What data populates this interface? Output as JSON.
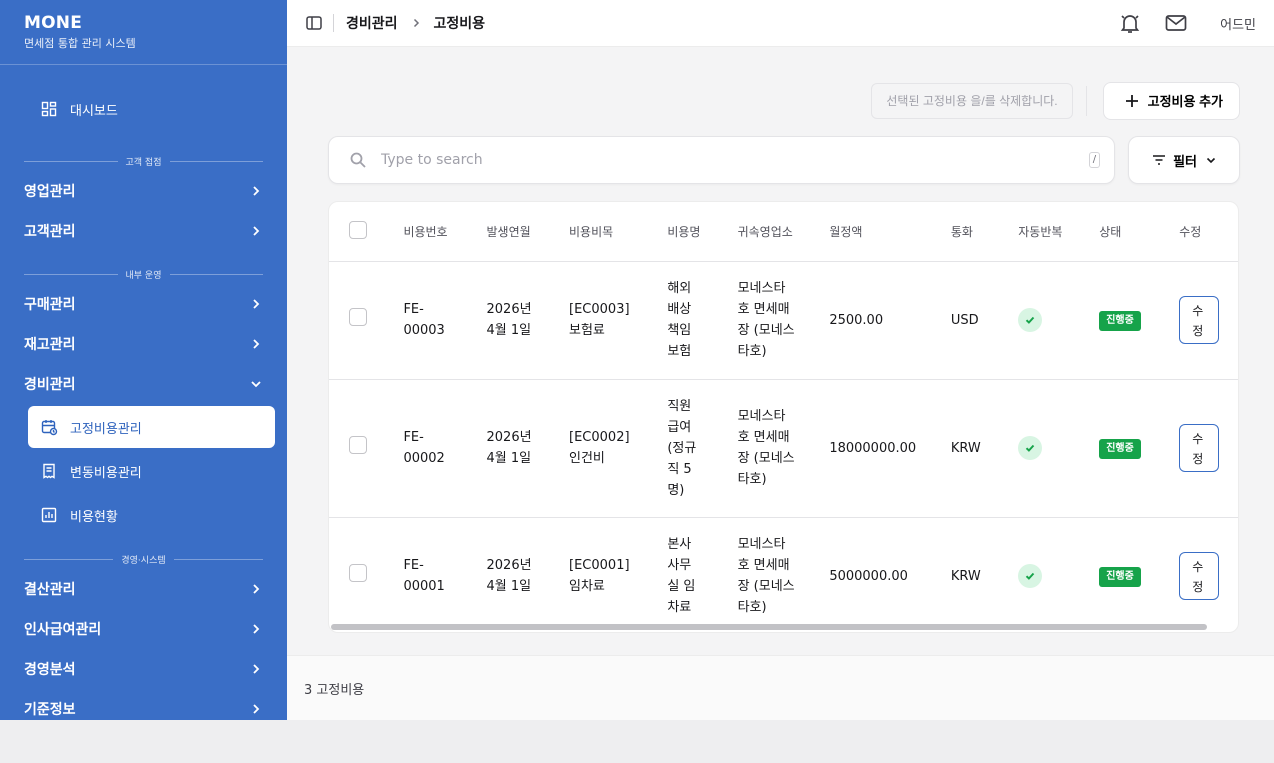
{
  "brand": {
    "title": "MONE",
    "subtitle": "면세점 통합 관리 시스템"
  },
  "sidebar": {
    "dashboard": "대시보드",
    "sections": {
      "customer": "고객 접점",
      "internal": "내부 운영",
      "management": "경영·시스템"
    },
    "items": {
      "sales": "영업관리",
      "customers": "고객관리",
      "purchase": "구매관리",
      "inventory": "재고관리",
      "expense": "경비관리",
      "settlement": "결산관리",
      "hr": "인사급여관리",
      "analysis": "경영분석",
      "master": "기준정보"
    },
    "expense_sub": {
      "fixed": "고정비용관리",
      "variable": "변동비용관리",
      "status": "비용현황"
    }
  },
  "breadcrumb": {
    "parent": "경비관리",
    "current": "고정비용"
  },
  "user": {
    "name": "어드민"
  },
  "actions": {
    "delete_label": "선택된 고정비용 을/를 삭제합니다.",
    "add_label": "고정비용 추가"
  },
  "search": {
    "placeholder": "Type to search",
    "shortcut": "/"
  },
  "filter": {
    "label": "필터"
  },
  "table": {
    "columns": {
      "id": "비용번호",
      "date": "발생연월",
      "category": "비용비목",
      "name": "비용명",
      "branch": "귀속영업소",
      "amount": "월정액",
      "currency": "통화",
      "recurring": "자동반복",
      "status": "상태",
      "edit": "수정"
    },
    "rows": [
      {
        "id_1": "FE-",
        "id_2": "00003",
        "date_1": "2026년",
        "date_2": "4월 1일",
        "category_1": "[EC0003]",
        "category_2": "보험료",
        "name_1": "해외",
        "name_2": "배상",
        "name_3": "책임",
        "name_4": "보험",
        "branch_1": "모네스타",
        "branch_2": "호 면세매",
        "branch_3": "장 (모네스",
        "branch_4": "타호)",
        "amount": "2500.00",
        "currency": "USD",
        "status": "진행중",
        "edit_1": "수",
        "edit_2": "정"
      },
      {
        "id_1": "FE-",
        "id_2": "00002",
        "date_1": "2026년",
        "date_2": "4월 1일",
        "category_1": "[EC0002]",
        "category_2": "인건비",
        "name_1": "직원",
        "name_2": "급여",
        "name_3": "(정규",
        "name_4": "직 5",
        "name_5": "명)",
        "branch_1": "모네스타",
        "branch_2": "호 면세매",
        "branch_3": "장 (모네스",
        "branch_4": "타호)",
        "amount": "18000000.00",
        "currency": "KRW",
        "status": "진행중",
        "edit_1": "수",
        "edit_2": "정"
      },
      {
        "id_1": "FE-",
        "id_2": "00001",
        "date_1": "2026년",
        "date_2": "4월 1일",
        "category_1": "[EC0001]",
        "category_2": "임차료",
        "name_1": "본사",
        "name_2": "사무",
        "name_3": "실 임",
        "name_4": "차료",
        "branch_1": "모네스타",
        "branch_2": "호 면세매",
        "branch_3": "장 (모네스",
        "branch_4": "타호)",
        "amount": "5000000.00",
        "currency": "KRW",
        "status": "진행중",
        "edit_1": "수",
        "edit_2": "정"
      }
    ]
  },
  "footer": {
    "count": "3 고정비용"
  },
  "colors": {
    "sidebar": "#3a6ec6",
    "active_text": "#2f63bd",
    "badge": "#16a34a",
    "check_bg": "#d8f5e3"
  },
  "icons": [
    "dashboard-icon",
    "calendar-icon",
    "receipt-icon",
    "chart-icon",
    "chevron-right-icon",
    "chevron-down-icon",
    "sidebar-toggle-icon",
    "bell-icon",
    "mail-icon",
    "plus-icon",
    "search-icon",
    "filter-icon",
    "check-icon"
  ]
}
